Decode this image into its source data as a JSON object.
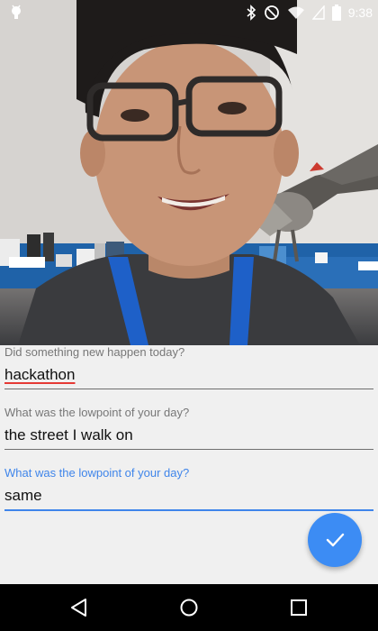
{
  "status_bar": {
    "time": "9:38",
    "icons": [
      "android-notification-icon",
      "bluetooth-icon",
      "do-not-disturb-icon",
      "wifi-icon",
      "signal-icon",
      "battery-icon"
    ]
  },
  "photo": {
    "description_icon": "camera-preview"
  },
  "form": {
    "fields": [
      {
        "label": "Did something new happen today?",
        "value": "hackathon"
      },
      {
        "label": "What was the lowpoint of your day?",
        "value": "the street I walk on"
      },
      {
        "label": "What was the lowpoint of your day?",
        "value": "same"
      }
    ],
    "submit_icon": "check-icon"
  },
  "nav_bar": {
    "icons": [
      "back-icon",
      "home-icon",
      "recents-icon"
    ]
  },
  "colors": {
    "accent": "#3f85ea",
    "fab": "#3c8cf4",
    "spellcheck": "#e53935",
    "background": "#f0f0f0"
  }
}
